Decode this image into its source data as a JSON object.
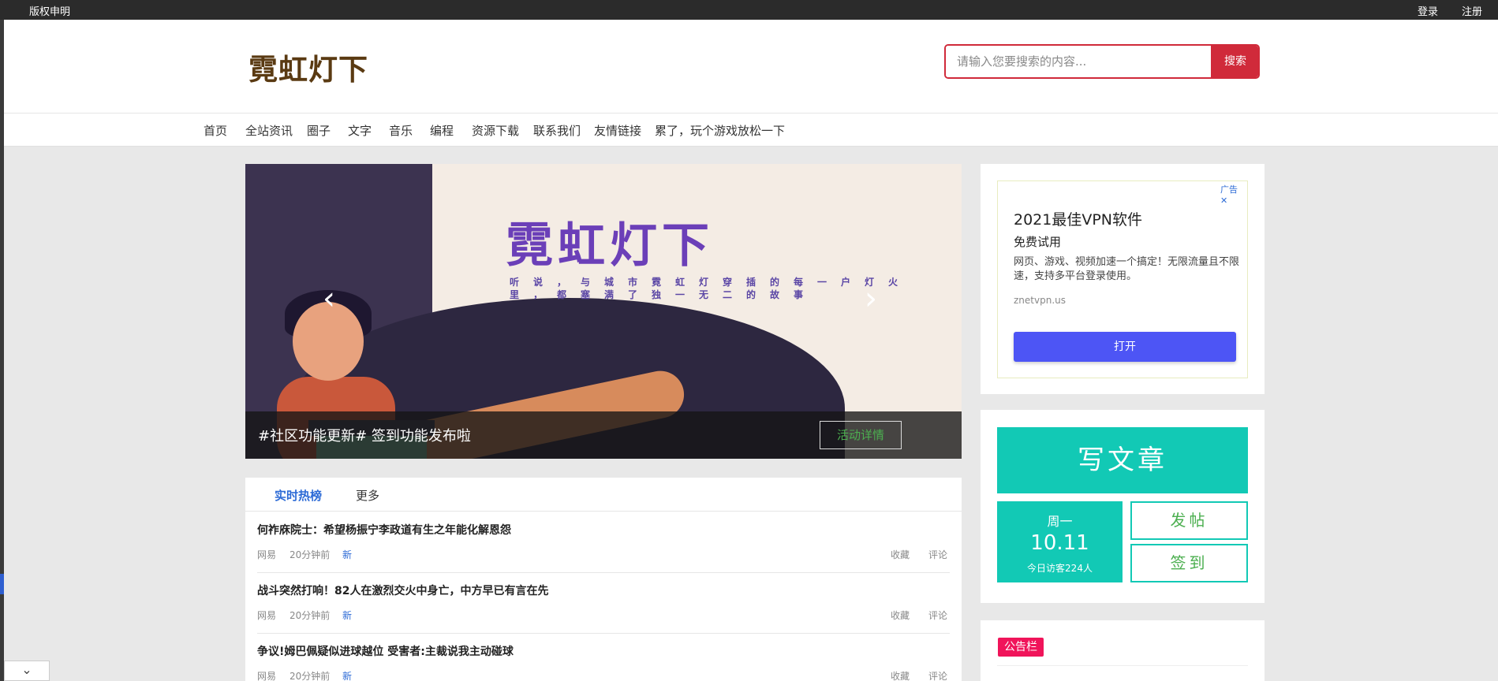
{
  "topbar": {
    "copyright": "版权申明",
    "login": "登录",
    "register": "注册"
  },
  "header": {
    "logo": "霓虹灯下",
    "search_placeholder": "请输入您要搜索的内容...",
    "search_button": "搜索"
  },
  "nav": [
    "首页",
    "全站资讯",
    "圈子",
    "文字",
    "音乐",
    "编程",
    "资源下载",
    "联系我们",
    "友情链接",
    "累了，玩个游戏放松一下"
  ],
  "banner": {
    "title": "霓虹灯下",
    "subtitle_line1": "听说，与城市霓虹灯穿插的每一户灯火",
    "subtitle_line2": "里，都塞满了独一无二的故事",
    "caption": "#社区功能更新# 签到功能发布啦",
    "details_button": "活动详情",
    "prev_icon": "chevron-left-icon",
    "next_icon": "chevron-right-icon"
  },
  "hot": {
    "tab_active": "实时热榜",
    "tab_more": "更多",
    "items": [
      {
        "title": "何祚庥院士：希望杨振宁李政道有生之年能化解恩怨",
        "source": "网易",
        "time": "20分钟前",
        "badge": "新",
        "fav": "收藏",
        "comment": "评论"
      },
      {
        "title": "战斗突然打响！82人在激烈交火中身亡，中方早已有言在先",
        "source": "网易",
        "time": "20分钟前",
        "badge": "新",
        "fav": "收藏",
        "comment": "评论"
      },
      {
        "title": "争议!姆巴佩疑似进球越位 受害者:主裁说我主动碰球",
        "source": "网易",
        "time": "20分钟前",
        "badge": "新",
        "fav": "收藏",
        "comment": "评论"
      }
    ]
  },
  "ad": {
    "badge": "广告",
    "headline": "2021最佳VPN软件",
    "subhead": "免费试用",
    "desc": "网页、游戏、视频加速一个搞定！无限流量且不限速，支持多平台登录使用。",
    "url": "znetvpn.us",
    "button": "打开"
  },
  "write": {
    "big": "写文章",
    "weekday": "周一",
    "date": "10.11",
    "visitors": "今日访客224人",
    "post": "发帖",
    "sign": "签到"
  },
  "notice": {
    "tag": "公告栏"
  },
  "colors": {
    "accent_red": "#d02a3a",
    "teal": "#12c9b5",
    "blue": "#2d6bd6",
    "pink": "#f0145a",
    "ad_button": "#4d55f5"
  }
}
